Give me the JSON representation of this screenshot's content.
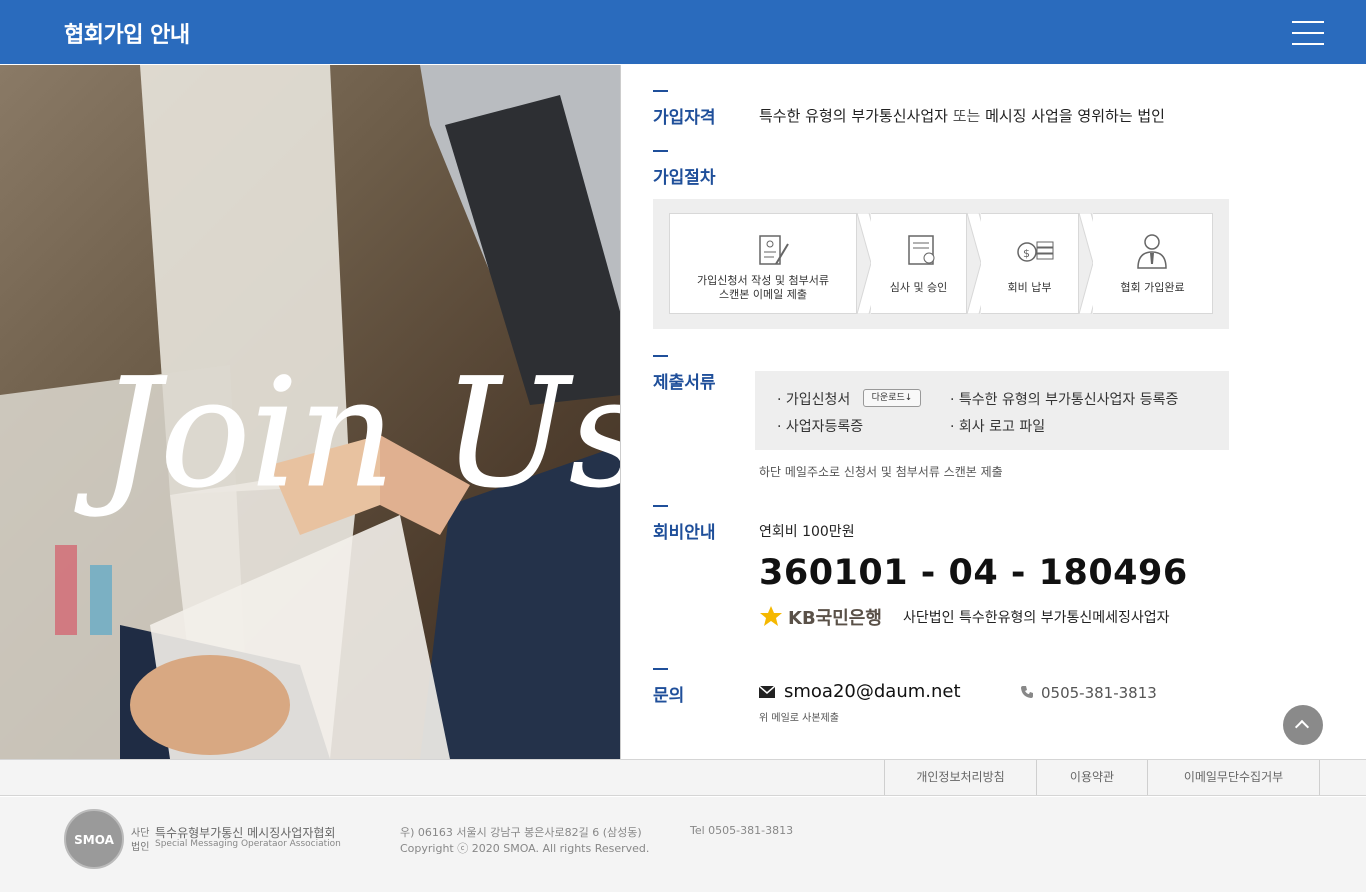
{
  "header": {
    "title": "협회가입 안내"
  },
  "hero": {
    "script_text": "Join Us"
  },
  "qualification": {
    "label": "가입자격",
    "text_a": "특수한 유형의 부가통신사업자",
    "text_or": " 또는 ",
    "text_b": "메시징 사업을 영위하는 법인"
  },
  "procedure": {
    "label": "가입절차",
    "steps": [
      {
        "line1": "가입신청서 작성 및 첨부서류",
        "line2": "스캔본 이메일 제출",
        "icon": "document-edit-icon"
      },
      {
        "line1": "심사 및 승인",
        "icon": "certificate-icon"
      },
      {
        "line1": "회비 납부",
        "icon": "coins-icon"
      },
      {
        "line1": "협회 가입완료",
        "icon": "person-tie-icon"
      }
    ]
  },
  "documents": {
    "label": "제출서류",
    "items": [
      "· 가입신청서",
      "· 사업자등록증",
      "· 특수한 유형의 부가통신사업자 등록증",
      "· 회사 로고 파일"
    ],
    "download_label": "다운로드↓",
    "note": "하단 메일주소로 신청서 및 첨부서류 스캔본 제출"
  },
  "fee": {
    "label": "회비안내",
    "annual": "연회비 100만원",
    "account_number": "360101 - 04 - 180496",
    "bank": "KB국민은행",
    "holder": "사단법인 특수한유형의 부가통신메세징사업자"
  },
  "contact": {
    "label": "문의",
    "email": "smoa20@daum.net",
    "email_note": "위 메일로 사본제출",
    "phone": "0505-381-3813"
  },
  "footer": {
    "links": [
      "개인정보처리방침",
      "이용약관",
      "이메일무단수집거부"
    ],
    "logo_text": "SMOA",
    "org_prefix_1": "사단",
    "org_prefix_2": "법인",
    "org_name_ko": "특수유형부가통신 메시징사업자협회",
    "org_name_en": "Special Messaging Operataor Association",
    "address": "우) 06163 서울시 강남구 봉은사로82길 6 (삼성동)",
    "tel": "Tel 0505-381-3813",
    "copyright": "Copyright ⓒ 2020 SMOA. All rights Reserved."
  },
  "colors": {
    "header_bg": "#2a6bbd",
    "accent": "#1f4f9a",
    "footer_bg": "#f4f4f4"
  }
}
